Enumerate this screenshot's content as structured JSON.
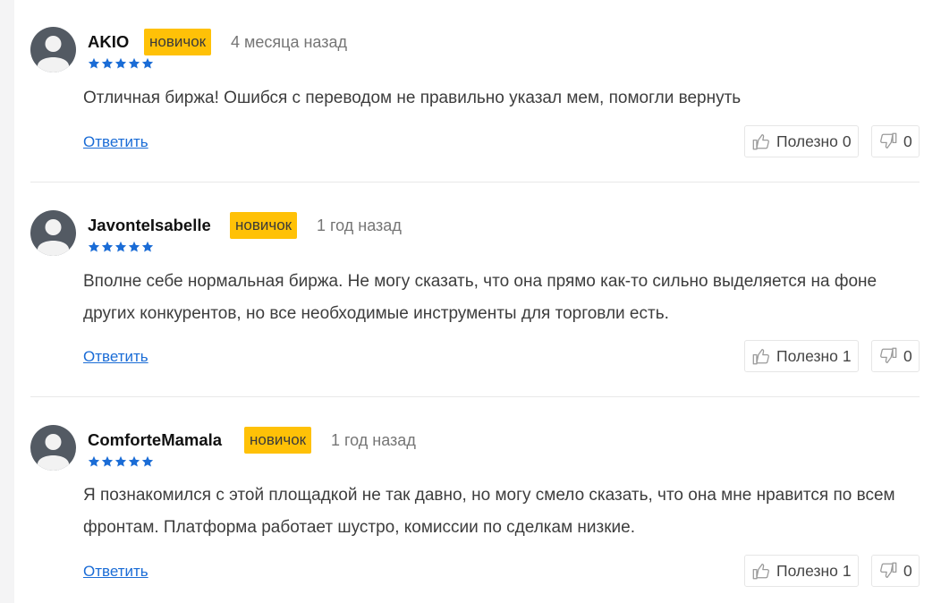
{
  "colors": {
    "badge": "#ffc107",
    "star": "#1a6cd6",
    "link": "#1a6cd6",
    "avatar": "#535a63"
  },
  "icons": {
    "avatar": "user-avatar-icon",
    "star": "star-icon",
    "like": "thumbs-up-icon",
    "dislike": "thumbs-down-icon"
  },
  "reviews": [
    {
      "author": "AKIO",
      "badge": "новичок",
      "time": "4 месяца назад",
      "rating": 5,
      "text": "Отличная биржа! Ошибся с переводом не правильно указал мем, помогли вернуть",
      "reply": "Ответить",
      "helpful_label": "Полезно",
      "helpful_count": "0",
      "unhelpful_count": "0"
    },
    {
      "author": "JavonteIsabelle",
      "badge": "новичок",
      "time": "1 год назад",
      "rating": 5,
      "text": "Вполне себе нормальная биржа. Не могу сказать, что она прямо как-то сильно выделяется на фоне других конкурентов, но все необходимые инструменты для торговли есть.",
      "reply": "Ответить",
      "helpful_label": "Полезно",
      "helpful_count": "1",
      "unhelpful_count": "0"
    },
    {
      "author": "ComforteMamala",
      "badge": "новичок",
      "time": "1 год назад",
      "rating": 5,
      "text": "Я познакомился с этой площадкой не так давно, но могу смело сказать, что она мне нравится по всем фронтам. Платформа работает шустро, комиссии по сделкам низкие.",
      "reply": "Ответить",
      "helpful_label": "Полезно",
      "helpful_count": "1",
      "unhelpful_count": "0"
    }
  ]
}
